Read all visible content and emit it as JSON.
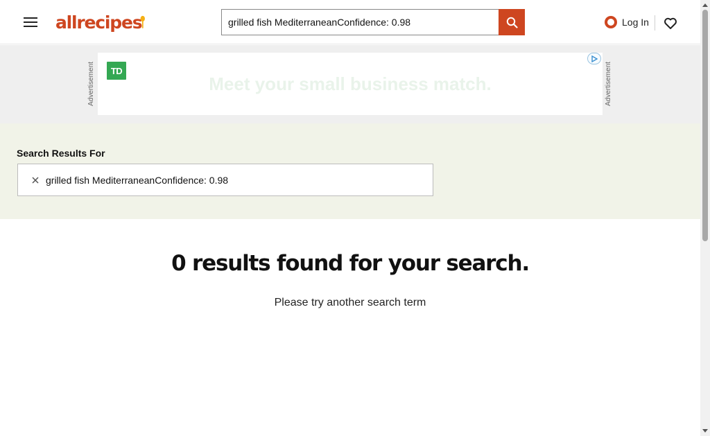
{
  "header": {
    "menu_icon": "hamburger-menu-icon",
    "logo": {
      "text": "allrecipes",
      "icon": "spoon-icon",
      "color": "#ce4620"
    },
    "search": {
      "value": "grilled fish MediterraneanConfidence: 0.98",
      "button_icon": "search-icon",
      "button_color": "#ce4620"
    },
    "login": {
      "label": "Log In",
      "icon": "user-icon"
    },
    "saved_icon": "heart-icon"
  },
  "ad": {
    "side_label": "Advertisement",
    "brand_logo_text": "TD",
    "headline": "Meet your small business match.",
    "adchoices_icon": "adchoices-icon",
    "brand_color": "#34a853"
  },
  "results": {
    "label": "Search Results For",
    "query_value": "grilled fish MediterraneanConfidence: 0.98",
    "clear_icon": "close-icon"
  },
  "empty_state": {
    "title": "0 results found for your search.",
    "subtitle": "Please try another search term"
  }
}
